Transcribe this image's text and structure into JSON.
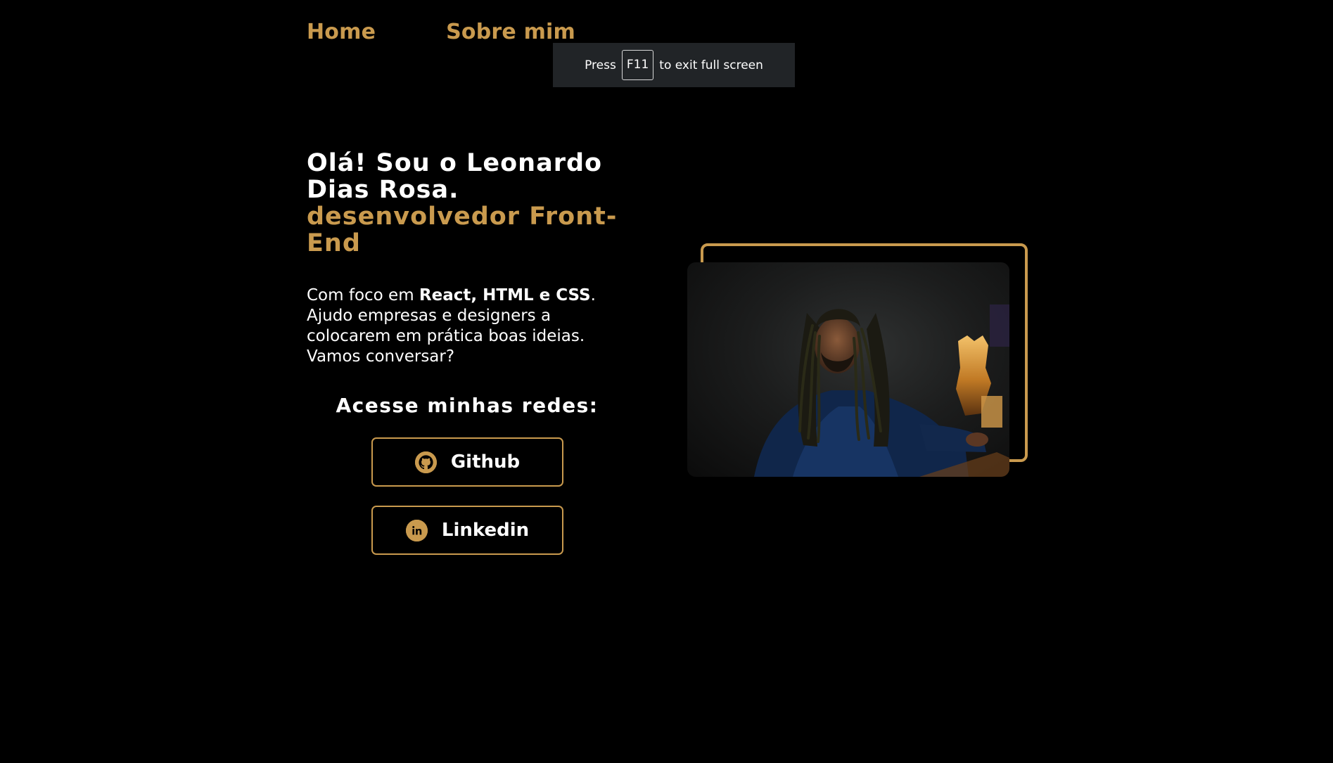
{
  "nav": {
    "items": [
      {
        "label": "Home"
      },
      {
        "label": "Sobre mim"
      }
    ]
  },
  "fullscreen_notice": {
    "before": "Press",
    "key": "F11",
    "after": "to exit full screen"
  },
  "hero": {
    "greeting_line1": "Olá! Sou o Leonardo",
    "greeting_line2": "Dias Rosa.",
    "role_line1": "desenvolvedor Front-",
    "role_line2": "End",
    "intro_prefix": "Com foco em ",
    "intro_highlight": "React, HTML e CSS",
    "intro_suffix": ". Ajudo empresas e designers a colocarem em prática boas ideias. Vamos conversar?"
  },
  "socials": {
    "heading": "Acesse minhas redes:",
    "buttons": [
      {
        "label": "Github",
        "icon": "github-icon"
      },
      {
        "label": "Linkedin",
        "icon": "linkedin-icon"
      }
    ]
  },
  "colors": {
    "background": "#000000",
    "accent": "#c99a4e",
    "text": "#ffffff",
    "toast": "#212427"
  }
}
